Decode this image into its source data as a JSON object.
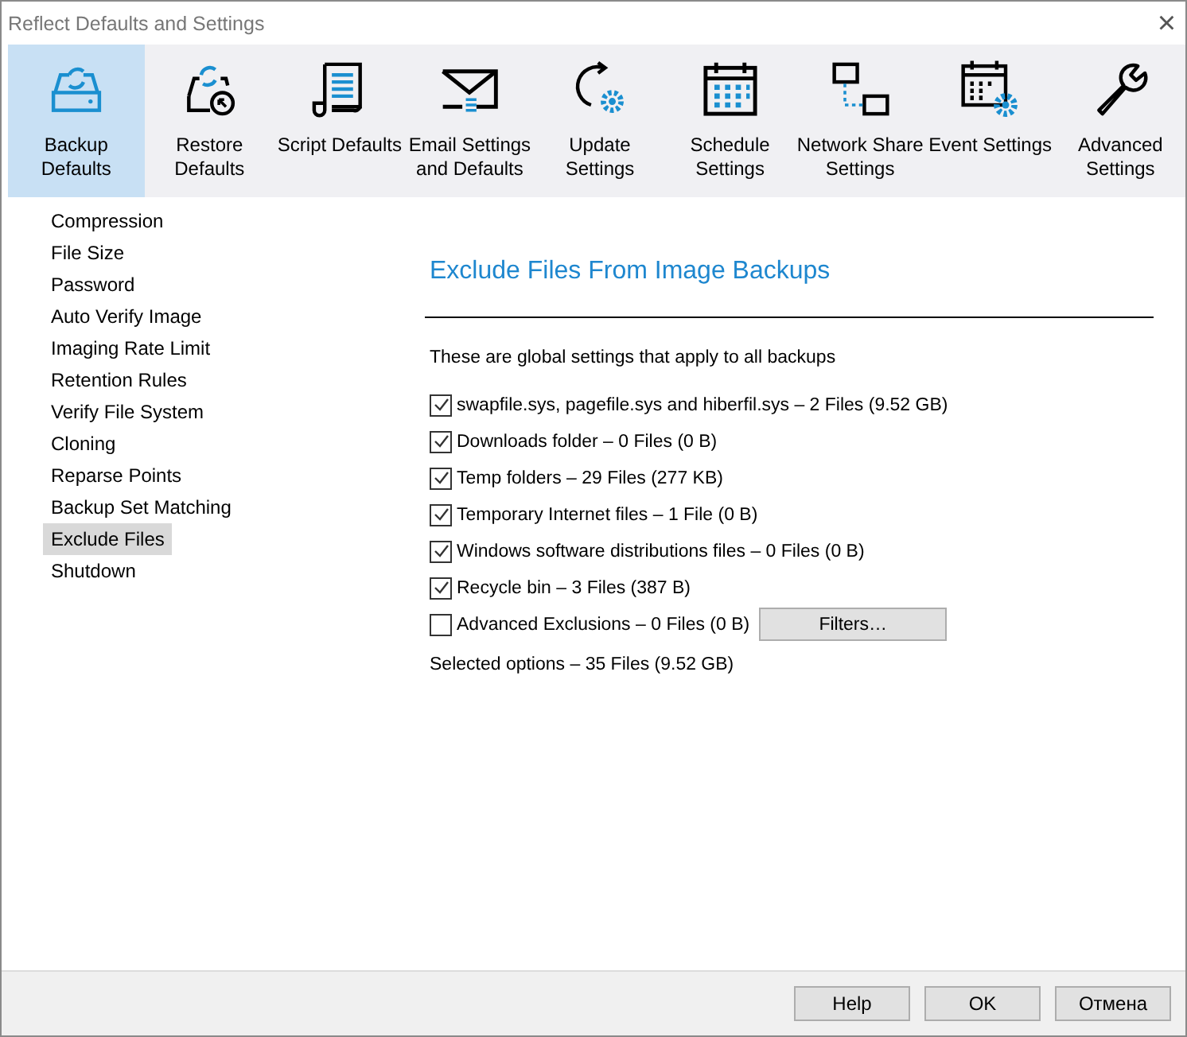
{
  "window": {
    "title": "Reflect Defaults and Settings",
    "close": "×"
  },
  "toolbar": [
    {
      "label": "Backup Defaults",
      "selected": true
    },
    {
      "label": "Restore Defaults",
      "selected": false
    },
    {
      "label": "Script Defaults",
      "selected": false
    },
    {
      "label": "Email Settings and Defaults",
      "selected": false
    },
    {
      "label": "Update Settings",
      "selected": false
    },
    {
      "label": "Schedule Settings",
      "selected": false
    },
    {
      "label": "Network Share Settings",
      "selected": false
    },
    {
      "label": "Event Settings",
      "selected": false
    },
    {
      "label": "Advanced Settings",
      "selected": false
    }
  ],
  "sidebar": {
    "items": [
      {
        "label": "Compression",
        "selected": false
      },
      {
        "label": "File Size",
        "selected": false
      },
      {
        "label": "Password",
        "selected": false
      },
      {
        "label": "Auto Verify Image",
        "selected": false
      },
      {
        "label": "Imaging Rate Limit",
        "selected": false
      },
      {
        "label": "Retention Rules",
        "selected": false
      },
      {
        "label": "Verify File System",
        "selected": false
      },
      {
        "label": "Cloning",
        "selected": false
      },
      {
        "label": "Reparse Points",
        "selected": false
      },
      {
        "label": "Backup Set Matching",
        "selected": false
      },
      {
        "label": "Exclude Files",
        "selected": true
      },
      {
        "label": "Shutdown",
        "selected": false
      }
    ]
  },
  "content": {
    "heading": "Exclude Files From Image Backups",
    "intro": "These are global settings that apply to all backups",
    "options": [
      {
        "label": "swapfile.sys, pagefile.sys and hiberfil.sys – 2 Files (9.52 GB)",
        "checked": true
      },
      {
        "label": "Downloads folder – 0 Files (0 B)",
        "checked": true
      },
      {
        "label": "Temp folders – 29 Files (277 KB)",
        "checked": true
      },
      {
        "label": "Temporary Internet files – 1 File (0 B)",
        "checked": true
      },
      {
        "label": "Windows software distributions files – 0 Files (0 B)",
        "checked": true
      },
      {
        "label": "Recycle bin – 3 Files (387 B)",
        "checked": true
      },
      {
        "label": "Advanced Exclusions – 0 Files (0 B)",
        "checked": false,
        "button": "Filters…"
      }
    ],
    "summary": "Selected options – 35 Files (9.52 GB)"
  },
  "buttons": [
    "Help",
    "OK",
    "Отмена"
  ]
}
